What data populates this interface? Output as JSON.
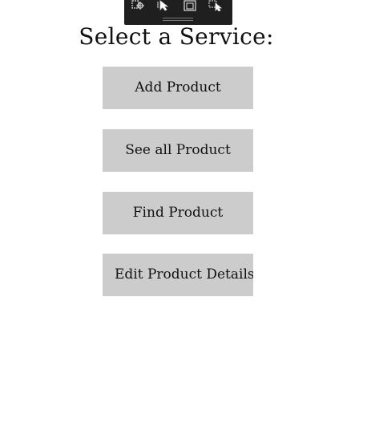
{
  "devtools_toolbar": {
    "tools": [
      {
        "icon": "select-element-icon"
      },
      {
        "icon": "pointer-icon"
      },
      {
        "icon": "frame-icon"
      },
      {
        "icon": "pointer-select-icon"
      }
    ]
  },
  "main": {
    "title": "Select a Service:",
    "buttons": [
      {
        "label": "Add Product"
      },
      {
        "label": "See all Product"
      },
      {
        "label": "Find Product"
      },
      {
        "label": "Edit Product Details"
      }
    ]
  },
  "colors": {
    "button_bg": "#cccccc",
    "toolbar_bg": "#1f1f1f",
    "background": "#ffffff",
    "text": "#111111"
  }
}
